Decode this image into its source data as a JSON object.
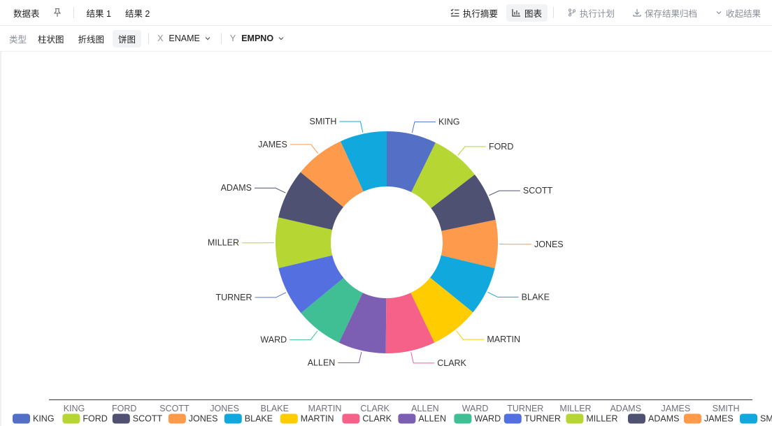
{
  "toolbar": {
    "data_table": "数据表",
    "result1": "结果 1",
    "result2": "结果 2",
    "summary": "执行摘要",
    "chart": "图表",
    "plan": "执行计划",
    "save": "保存结果归档",
    "collapse": "收起结果",
    "icons": [
      "pin-icon",
      "list-check-icon",
      "bar-chart-icon",
      "branch-icon",
      "download-icon",
      "chevron-down-icon"
    ]
  },
  "config": {
    "type_label": "类型",
    "types": [
      "柱状图",
      "折线图",
      "饼图"
    ],
    "active_type": "饼图",
    "x_key": "X",
    "x_value": "ENAME",
    "y_key": "Y",
    "y_value": "EMPNO"
  },
  "chart_data": {
    "type": "pie",
    "variant": "donut",
    "categories": [
      "KING",
      "FORD",
      "SCOTT",
      "JONES",
      "BLAKE",
      "MARTIN",
      "CLARK",
      "ALLEN",
      "WARD",
      "TURNER",
      "MILLER",
      "ADAMS",
      "JAMES",
      "SMITH"
    ],
    "values": [
      7839,
      7902,
      7788,
      7566,
      7698,
      7654,
      7782,
      7499,
      7521,
      7844,
      7934,
      7876,
      7900,
      7369
    ],
    "colors": [
      "#5470c6",
      "#b5d633",
      "#4f5173",
      "#fd9a4b",
      "#11a8de",
      "#ffcc00",
      "#f6618a",
      "#7c5fb3",
      "#3fbf93",
      "#5470e0",
      "#b5d633",
      "#4f5173",
      "#fd9a4b",
      "#11a8de"
    ],
    "legend_position": "bottom",
    "legend_axis_labels": [
      "KING",
      "FORD",
      "SCOTT",
      "JONES",
      "BLAKE",
      "MARTIN",
      "CLARK",
      "ALLEN",
      "WARD",
      "TURNER",
      "MILLER",
      "ADAMS",
      "JAMES",
      "SMITH"
    ]
  }
}
